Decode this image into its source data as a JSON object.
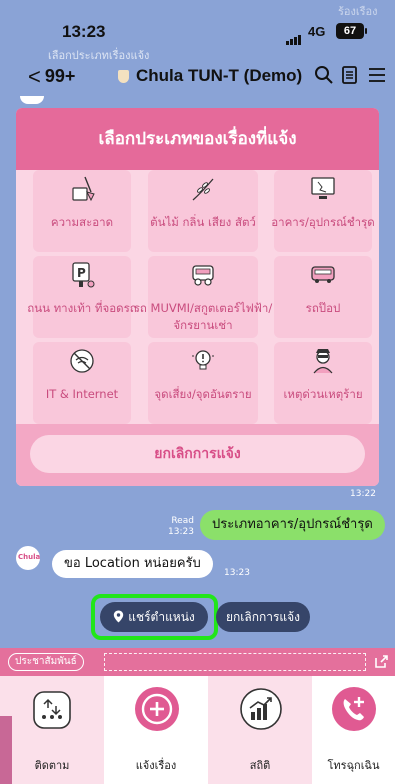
{
  "status_bar": {
    "time": "13:23",
    "network": "4G",
    "battery": "67"
  },
  "ghost_text": {
    "top_right": "ร้องเรือง",
    "preview": "เลือกประเภทเรื่องแจ้ง"
  },
  "nav": {
    "back_count": "99+",
    "chat_name": "Chula TUN-T (Demo)"
  },
  "card": {
    "title": "เลือกประเภทของเรื่องที่แจ้ง",
    "tiles": [
      {
        "label": "ความสะอาด",
        "icon": "broom-bucket-icon"
      },
      {
        "label": "ต้นไม้ กลิ่น เสียง สัตว์",
        "icon": "leaf-icon"
      },
      {
        "label": "อาคาร/อุปกรณ์ชำรุด",
        "icon": "broken-screen-icon"
      },
      {
        "label": "ถนน ทางเท้า ที่จอดรถ",
        "icon": "parking-sign-icon"
      },
      {
        "label": "รถ MUVMI/สกูตเตอร์ไฟฟ้า/จักรยานเช่า",
        "icon": "tuktuk-icon"
      },
      {
        "label": "รถป๊อป",
        "icon": "bus-icon"
      },
      {
        "label": "IT & Internet",
        "icon": "no-wifi-icon"
      },
      {
        "label": "จุดเสี่ยง/จุดอันตราย",
        "icon": "bulb-warning-icon"
      },
      {
        "label": "เหตุด่วนเหตุร้าย",
        "icon": "thief-icon"
      }
    ],
    "cancel_label": "ยกเลิกการแจ้ง"
  },
  "chat": {
    "card_time": "13:22",
    "read_label": "Read",
    "out_time": "13:23",
    "out_message": "ประเภทอาคาร/อุปกรณ์ชำรุด",
    "avatar_label": "Chula",
    "in_message": "ขอ Location หน่อยครับ",
    "in_time": "13:23"
  },
  "quick_replies": {
    "share_location": "แชร์ตำแหน่ง",
    "cancel": "ยกเลิกการแจ้ง"
  },
  "menu_bar": {
    "pr_label": "ประชาสัมพันธ์"
  },
  "rich_menu": [
    {
      "label": "ติดตาม",
      "icon": "track-status-icon"
    },
    {
      "label": "แจ้งเรื่อง",
      "icon": "add-circle-icon"
    },
    {
      "label": "สถิติ",
      "icon": "stats-chart-icon"
    },
    {
      "label": "โทรฉุกเฉิน",
      "icon": "emergency-call-icon"
    }
  ],
  "colors": {
    "accent": "#e56a9a",
    "highlight": "#22e61a",
    "background": "#8aa3d6"
  }
}
